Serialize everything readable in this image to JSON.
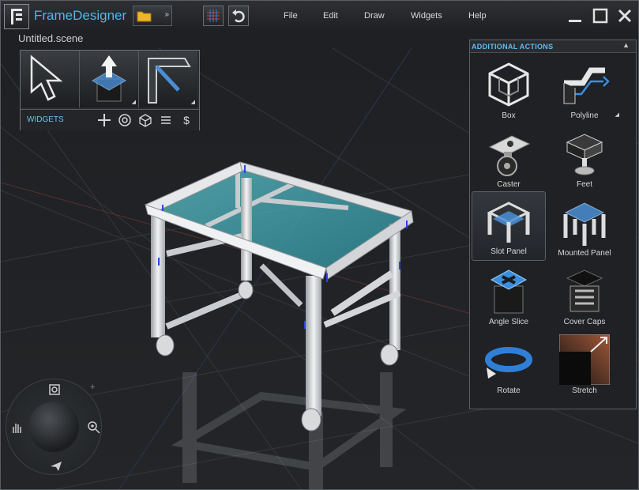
{
  "app": {
    "name": "FrameDesigner",
    "file_name": "Untitled.scene"
  },
  "menu": {
    "items": [
      "File",
      "Edit",
      "Draw",
      "Widgets",
      "Help"
    ]
  },
  "toolbar": {
    "open_more": "»"
  },
  "tools": {
    "items": [
      {
        "icon": "select-arrow-icon"
      },
      {
        "icon": "extrude-icon"
      },
      {
        "icon": "frame-profile-icon"
      }
    ],
    "widgets_label": "WIDGETS",
    "widget_icons": [
      "plus-icon",
      "target-icon",
      "cube-icon",
      "list-icon",
      "dollar-icon"
    ]
  },
  "actions": {
    "title": "ADDITIONAL ACTIONS",
    "items": [
      {
        "label": "Box",
        "icon": "box-icon"
      },
      {
        "label": "Polyline",
        "icon": "polyline-icon"
      },
      {
        "label": "Caster",
        "icon": "caster-icon"
      },
      {
        "label": "Feet",
        "icon": "feet-icon"
      },
      {
        "label": "Slot Panel",
        "icon": "slot-panel-icon",
        "selected": true
      },
      {
        "label": "Mounted Panel",
        "icon": "mounted-panel-icon"
      },
      {
        "label": "Angle Slice",
        "icon": "angle-slice-icon"
      },
      {
        "label": "Cover Caps",
        "icon": "cover-caps-icon"
      },
      {
        "label": "Rotate",
        "icon": "rotate-icon"
      },
      {
        "label": "Stretch",
        "icon": "stretch-icon"
      }
    ]
  },
  "colors": {
    "accent": "#4fb6ea",
    "glass": "#3fa3b0",
    "frame_metal": "#d8dadd",
    "background": "#1c1e21"
  }
}
